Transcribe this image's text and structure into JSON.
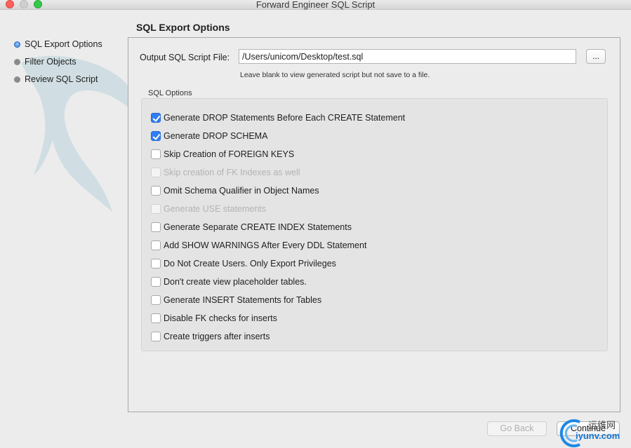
{
  "window": {
    "title": "Forward Engineer SQL Script"
  },
  "sidebar": {
    "items": [
      {
        "label": "SQL Export Options",
        "active": true
      },
      {
        "label": "Filter Objects",
        "active": false
      },
      {
        "label": "Review SQL Script",
        "active": false
      }
    ]
  },
  "main": {
    "heading": "SQL Export Options",
    "output_file": {
      "label": "Output SQL Script File:",
      "value": "/Users/unicom/Desktop/test.sql",
      "browse_label": "...",
      "hint": "Leave blank to view generated script but not save to a file."
    },
    "options_section": {
      "label": "SQL Options",
      "options": [
        {
          "label": "Generate DROP Statements Before Each CREATE Statement",
          "checked": true,
          "enabled": true
        },
        {
          "label": "Generate DROP SCHEMA",
          "checked": true,
          "enabled": true
        },
        {
          "label": "Skip Creation of FOREIGN KEYS",
          "checked": false,
          "enabled": true
        },
        {
          "label": "Skip creation of FK Indexes as well",
          "checked": false,
          "enabled": false
        },
        {
          "label": "Omit Schema Qualifier in Object Names",
          "checked": false,
          "enabled": true
        },
        {
          "label": "Generate USE statements",
          "checked": false,
          "enabled": false
        },
        {
          "label": "Generate Separate CREATE INDEX Statements",
          "checked": false,
          "enabled": true
        },
        {
          "label": "Add SHOW WARNINGS After Every DDL Statement",
          "checked": false,
          "enabled": true
        },
        {
          "label": "Do Not Create Users. Only Export Privileges",
          "checked": false,
          "enabled": true
        },
        {
          "label": "Don't create view placeholder tables.",
          "checked": false,
          "enabled": true
        },
        {
          "label": "Generate INSERT Statements for Tables",
          "checked": false,
          "enabled": true
        },
        {
          "label": "Disable FK checks for inserts",
          "checked": false,
          "enabled": true
        },
        {
          "label": "Create triggers after inserts",
          "checked": false,
          "enabled": true
        }
      ]
    }
  },
  "footer": {
    "back_label": "Go Back",
    "continue_label": "Continue"
  },
  "watermark": {
    "line1": "运维网",
    "line2": "iyunv.com"
  },
  "colors": {
    "accent": "#2f7ef5",
    "panel_bg": "#ececec",
    "group_bg": "#e4e4e4",
    "watermark_blue": "#1976d2"
  }
}
